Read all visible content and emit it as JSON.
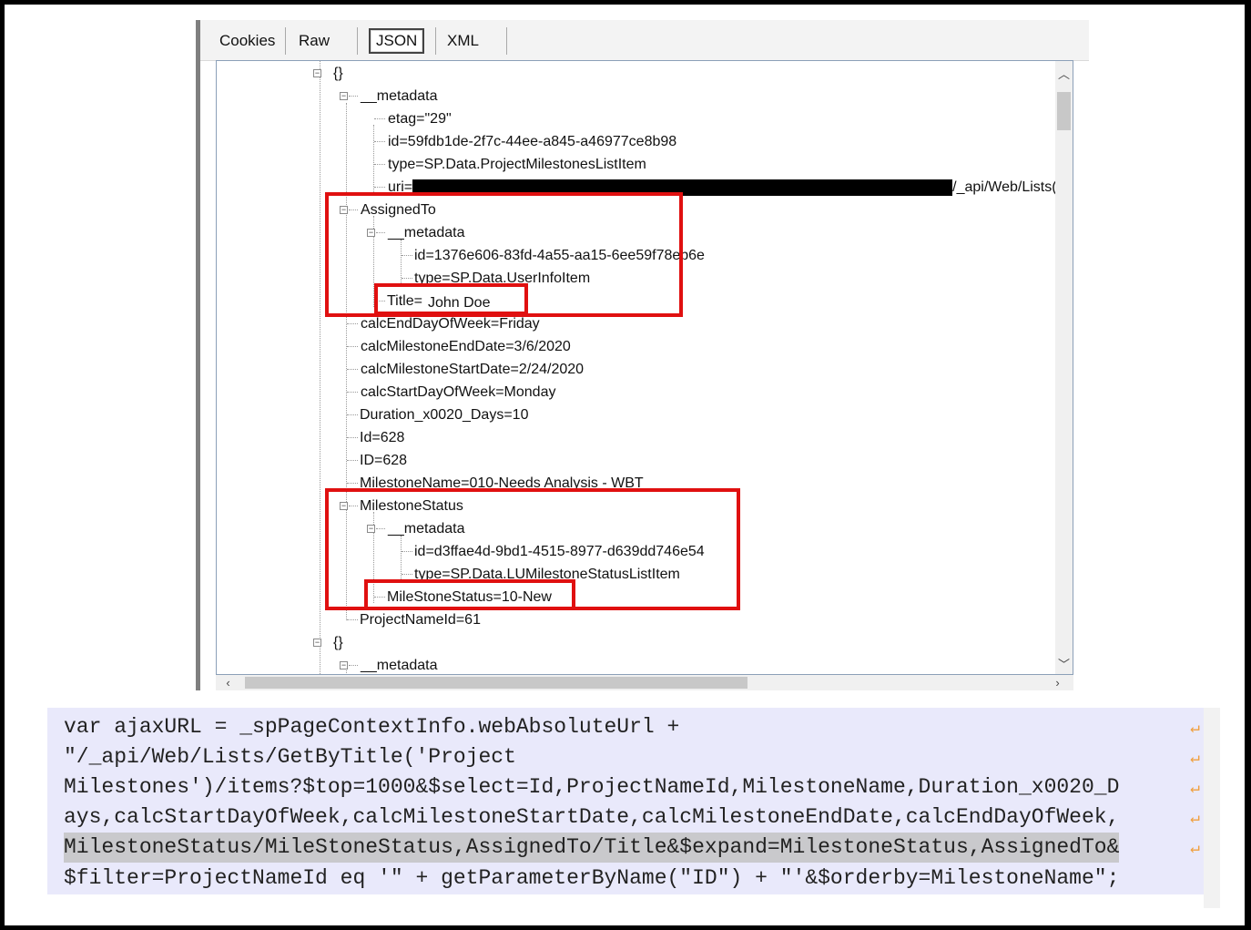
{
  "tabs": [
    "Cookies",
    "Raw",
    "JSON",
    "XML"
  ],
  "active_tab": "JSON",
  "tree": {
    "root_label": "{}",
    "metadata_label": "__metadata",
    "etag": "etag=\"29\"",
    "id": "id=59fdb1de-2f7c-44ee-a845-a46977ce8b98",
    "type": "type=SP.Data.ProjectMilestonesListItem",
    "uri_prefix": "uri=",
    "uri_suffix": "/_api/Web/Lists(g",
    "assigned_to": "AssignedTo",
    "assigned_metadata": "__metadata",
    "assigned_id": "id=1376e606-83fd-4a55-aa15-6ee59f78eb6e",
    "assigned_type": "type=SP.Data.UserInfoItem",
    "title_prefix": "Title=",
    "title_value": "John Doe",
    "calc_end_day": "calcEndDayOfWeek=Friday",
    "calc_end_date": "calcMilestoneEndDate=3/6/2020",
    "calc_start_date": "calcMilestoneStartDate=2/24/2020",
    "calc_start_day": "calcStartDayOfWeek=Monday",
    "duration": "Duration_x0020_Days=10",
    "id_lower": "Id=628",
    "id_upper": "ID=628",
    "milestone_name": "MilestoneName=010-Needs Analysis - WBT",
    "milestone_status": "MilestoneStatus",
    "status_metadata": "__metadata",
    "status_id": "id=d3ffae4d-9bd1-4515-8977-d639dd746e54",
    "status_type": "type=SP.Data.LUMilestoneStatusListItem",
    "status_value": "MileStoneStatus=10-New",
    "project_name_id": "ProjectNameId=61",
    "root2_label": "{}",
    "metadata2_label": "__metadata"
  },
  "code_lines": [
    "var ajaxURL = _spPageContextInfo.webAbsoluteUrl +",
    "\"/_api/Web/Lists/GetByTitle('Project",
    "Milestones')/items?$top=1000&$select=Id,ProjectNameId,MilestoneName,Duration_x0020_D",
    "ays,calcStartDayOfWeek,calcMilestoneStartDate,calcMilestoneEndDate,calcEndDayOfWeek,",
    "MilestoneStatus/MileStoneStatus,AssignedTo/Title&$expand=MilestoneStatus,AssignedTo&",
    "$filter=ProjectNameId eq '\" + getParameterByName(\"ID\") + \"'&$orderby=MilestoneName\";"
  ],
  "icons": {
    "collapse": "minus-box-icon",
    "wrap": "line-wrap-icon",
    "scroll_up": "chevron-up-icon",
    "scroll_down": "chevron-down-icon",
    "scroll_left": "chevron-left-icon",
    "scroll_right": "chevron-right-icon"
  },
  "colors": {
    "highlight_box": "#e01010",
    "code_background": "#e9e9fb",
    "wrap_icon": "#f0a040"
  }
}
